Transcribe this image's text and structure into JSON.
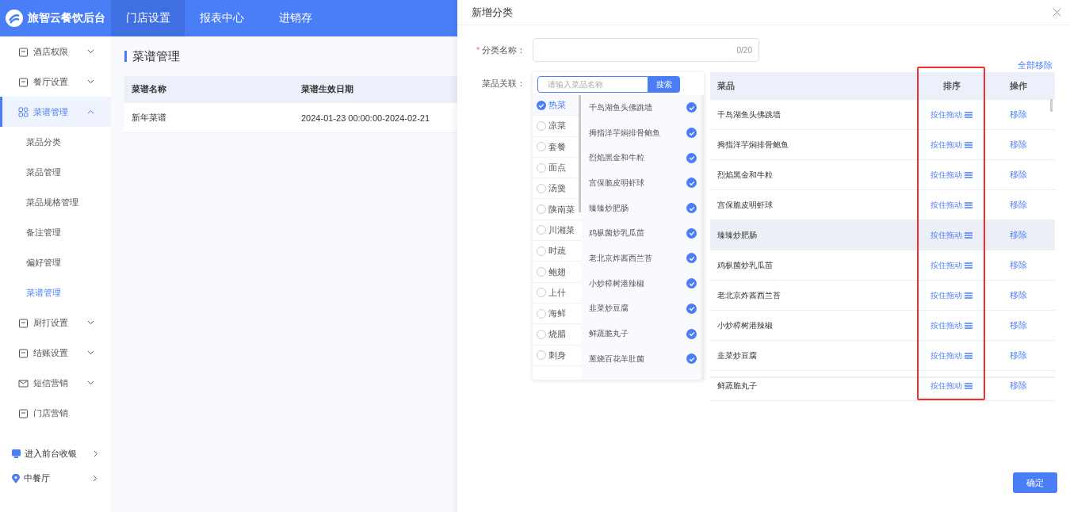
{
  "brand": {
    "name": "旅智云餐饮后台"
  },
  "top_nav": [
    {
      "label": "门店设置",
      "selected": true
    },
    {
      "label": "报表中心",
      "selected": false
    },
    {
      "label": "进销存",
      "selected": false
    }
  ],
  "sidebar": {
    "items": [
      {
        "label": "酒店权限",
        "expanded": false,
        "selected": false
      },
      {
        "label": "餐厅设置",
        "expanded": false,
        "selected": false
      },
      {
        "label": "菜谱管理",
        "expanded": true,
        "selected": true,
        "children": [
          {
            "label": "菜品分类",
            "selected": false
          },
          {
            "label": "菜品管理",
            "selected": false
          },
          {
            "label": "菜品规格管理",
            "selected": false
          },
          {
            "label": "备注管理",
            "selected": false
          },
          {
            "label": "偏好管理",
            "selected": false
          },
          {
            "label": "菜谱管理",
            "selected": true
          }
        ]
      },
      {
        "label": "厨打设置",
        "expanded": false,
        "selected": false
      },
      {
        "label": "结账设置",
        "expanded": false,
        "selected": false
      },
      {
        "label": "短信营销",
        "expanded": false,
        "selected": false
      },
      {
        "label": "门店营销",
        "selected": false
      }
    ],
    "footer_links": [
      {
        "label": "进入前台收银"
      },
      {
        "label": "中餐厅"
      }
    ]
  },
  "page": {
    "title": "菜谱管理",
    "table": {
      "columns": [
        "菜谱名称",
        "菜谱生效日期"
      ],
      "rows": [
        [
          "新年菜谱",
          "2024-01-23 00:00:00-2024-02-21"
        ]
      ]
    }
  },
  "drawer": {
    "title": "新增分类",
    "name_field": {
      "required_mark": "*",
      "label": "分类名称：",
      "counter": "0/20"
    },
    "remove_all": "全部移除",
    "dishes_label": "菜品关联：",
    "search": {
      "placeholder": "请输入菜品名称",
      "button": "搜索"
    },
    "categories": [
      {
        "label": "热菜",
        "selected": true
      },
      {
        "label": "凉菜",
        "selected": false
      },
      {
        "label": "套餐",
        "selected": false
      },
      {
        "label": "面点",
        "selected": false
      },
      {
        "label": "汤羹",
        "selected": false
      },
      {
        "label": "陕南菜",
        "selected": false
      },
      {
        "label": "川湘菜",
        "selected": false
      },
      {
        "label": "时蔬",
        "selected": false
      },
      {
        "label": "鲍翅",
        "selected": false
      },
      {
        "label": "上什",
        "selected": false
      },
      {
        "label": "海鲜",
        "selected": false
      },
      {
        "label": "烧腊",
        "selected": false
      },
      {
        "label": "刺身",
        "selected": false
      }
    ],
    "dishes": [
      {
        "label": "千岛湖鱼头佛跳墙",
        "checked": true
      },
      {
        "label": "拇指洋芋焖排骨鲍鱼",
        "checked": true
      },
      {
        "label": "烈焰黑金和牛粒",
        "checked": true
      },
      {
        "label": "宫保脆皮明虾球",
        "checked": true
      },
      {
        "label": "臻臻炒肥肠",
        "checked": true
      },
      {
        "label": "鸡枞菌炒乳瓜苗",
        "checked": true
      },
      {
        "label": "老北京炸酱西兰苔",
        "checked": true
      },
      {
        "label": "小炒樟树港辣椒",
        "checked": true
      },
      {
        "label": "韭菜炒豆腐",
        "checked": true
      },
      {
        "label": "鲜蔬脆丸子",
        "checked": true
      },
      {
        "label": "葱烧百花羊肚菌",
        "checked": true
      }
    ],
    "table": {
      "columns": [
        "菜品",
        "排序",
        "操作"
      ],
      "rows": [
        {
          "dish": "千岛湖鱼头佛跳墙",
          "sort": "按住拖动",
          "action": "移除",
          "hover": false
        },
        {
          "dish": "拇指洋芋焖排骨鲍鱼",
          "sort": "按住拖动",
          "action": "移除",
          "hover": false
        },
        {
          "dish": "烈焰黑金和牛粒",
          "sort": "按住拖动",
          "action": "移除",
          "hover": false
        },
        {
          "dish": "宫保脆皮明虾球",
          "sort": "按住拖动",
          "action": "移除",
          "hover": false
        },
        {
          "dish": "臻臻炒肥肠",
          "sort": "按住拖动",
          "action": "移除",
          "hover": true
        },
        {
          "dish": "鸡枞菌炒乳瓜苗",
          "sort": "按住拖动",
          "action": "移除",
          "hover": false
        },
        {
          "dish": "老北京炸酱西兰苔",
          "sort": "按住拖动",
          "action": "移除",
          "hover": false
        },
        {
          "dish": "小炒樟树港辣椒",
          "sort": "按住拖动",
          "action": "移除",
          "hover": false
        },
        {
          "dish": "韭菜炒豆腐",
          "sort": "按住拖动",
          "action": "移除",
          "hover": false
        },
        {
          "dish": "鲜蔬脆丸子",
          "sort": "按住拖动",
          "action": "移除",
          "hover": false
        }
      ]
    },
    "confirm": "确定"
  }
}
